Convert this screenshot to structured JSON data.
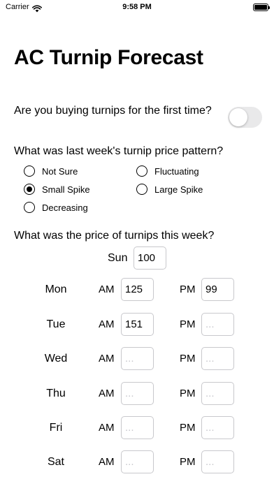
{
  "status_bar": {
    "carrier": "Carrier",
    "time": "9:58 PM"
  },
  "title": "AC Turnip Forecast",
  "first_time": {
    "question": "Are you buying turnips for the first time?",
    "enabled": false
  },
  "pattern": {
    "question": "What was last week's turnip price pattern?",
    "options": [
      "Not Sure",
      "Fluctuating",
      "Small Spike",
      "Large Spike",
      "Decreasing"
    ],
    "selected": "Small Spike"
  },
  "prices": {
    "question": "What was the price of turnips this week?",
    "sunday": {
      "label": "Sun",
      "value": "100"
    },
    "am_label": "AM",
    "pm_label": "PM",
    "placeholder": "...",
    "days": [
      {
        "label": "Mon",
        "am": "125",
        "pm": "99"
      },
      {
        "label": "Tue",
        "am": "151",
        "pm": ""
      },
      {
        "label": "Wed",
        "am": "",
        "pm": ""
      },
      {
        "label": "Thu",
        "am": "",
        "pm": ""
      },
      {
        "label": "Fri",
        "am": "",
        "pm": ""
      },
      {
        "label": "Sat",
        "am": "",
        "pm": ""
      }
    ]
  },
  "colors": {
    "toggle_off": "#e9e9ea",
    "input_border": "#c8c8cc",
    "placeholder": "#c7c7cc"
  }
}
